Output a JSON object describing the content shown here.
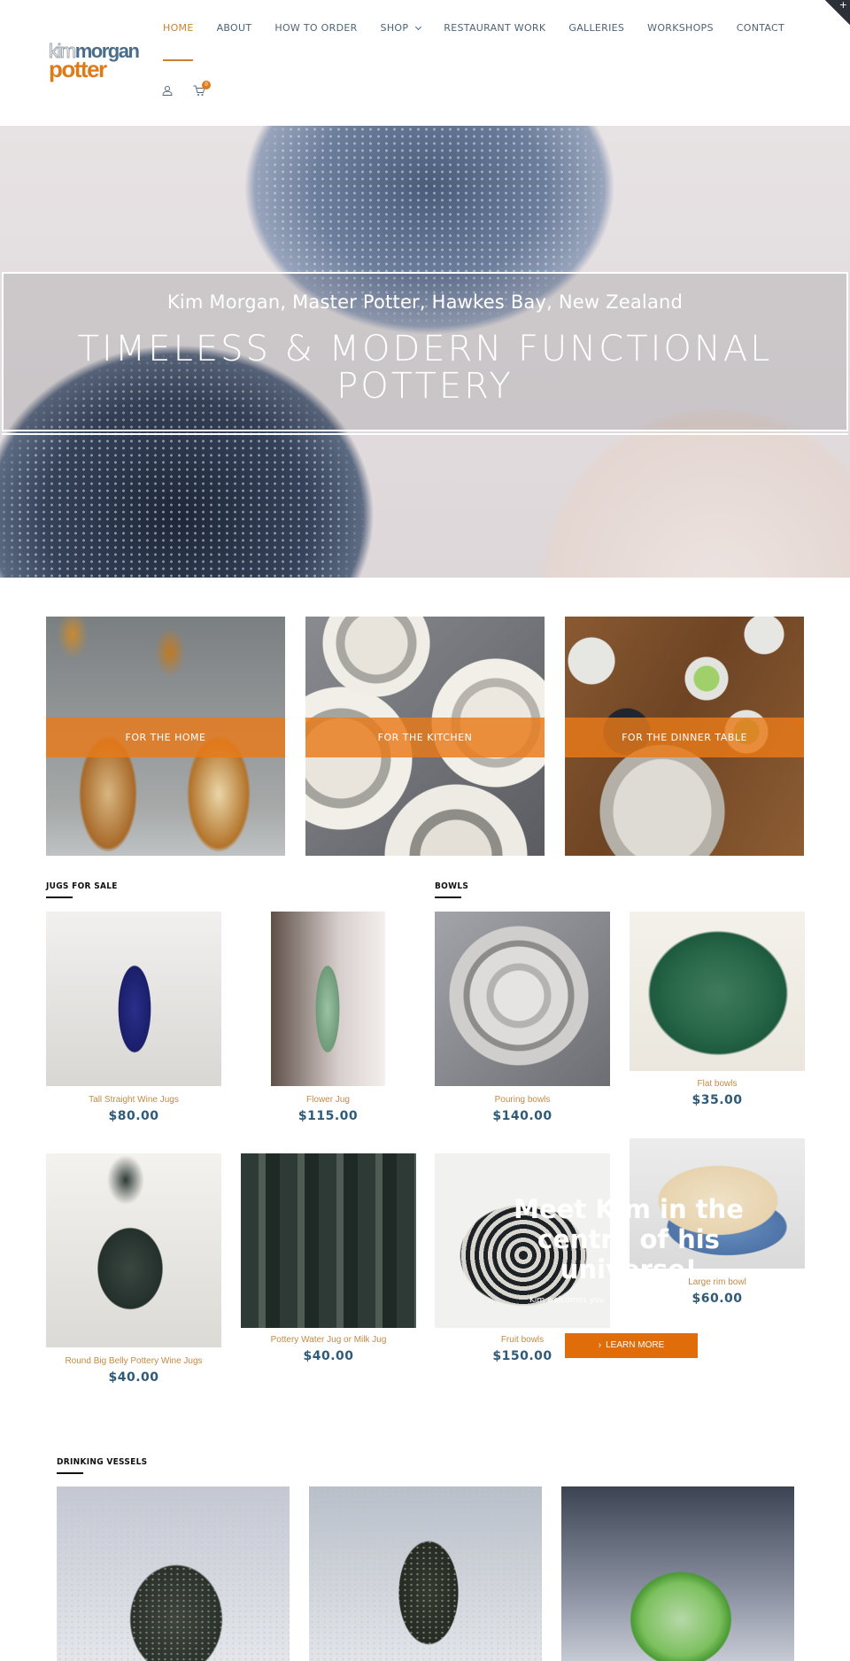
{
  "brand": {
    "logo_kim": "kim",
    "logo_morgan": "morgan",
    "logo_potter": "potter"
  },
  "nav": {
    "items": [
      {
        "label": "HOME",
        "active": true
      },
      {
        "label": "ABOUT"
      },
      {
        "label": "HOW TO ORDER"
      },
      {
        "label": "SHOP",
        "has_dropdown": true
      },
      {
        "label": "RESTAURANT WORK"
      },
      {
        "label": "GALLERIES"
      },
      {
        "label": "WORKSHOPS"
      },
      {
        "label": "CONTACT"
      }
    ],
    "cart_count": "0",
    "icons": [
      "user-icon",
      "cart-icon"
    ],
    "corner_toggle": "+"
  },
  "hero": {
    "subtitle": "Kim Morgan, Master Potter, Hawkes Bay, New Zealand",
    "title": "TIMELESS & MODERN FUNCTIONAL POTTERY"
  },
  "categories": [
    {
      "label": "FOR THE HOME"
    },
    {
      "label": "FOR THE KITCHEN"
    },
    {
      "label": "FOR THE DINNER TABLE"
    }
  ],
  "jugs": {
    "heading": "JUGS FOR SALE",
    "products": [
      {
        "name": "Tall Straight Wine Jugs",
        "price": "$80.00"
      },
      {
        "name": "Flower Jug",
        "price": "$115.00"
      },
      {
        "name": "Round Big Belly Pottery Wine Jugs",
        "price": "$40.00"
      },
      {
        "name": "Pottery Water Jug or Milk Jug",
        "price": "$40.00"
      }
    ]
  },
  "bowls": {
    "heading": "BOWLS",
    "products": [
      {
        "name": "Pouring bowls",
        "price": "$140.00"
      },
      {
        "name": "Flat bowls",
        "price": "$35.00"
      },
      {
        "name": "Fruit bowls",
        "price": "$150.00"
      },
      {
        "name": "Large rim bowl",
        "price": "$60.00"
      }
    ]
  },
  "promo": {
    "title": "Meet Kim in the centre of his universe!",
    "subtitle": "Kim welcomes you",
    "button": "LEARN MORE",
    "accent_color": "#e06d0a"
  },
  "drinking_vessels": {
    "heading": "DRINKING VESSELS"
  },
  "colors": {
    "accent_orange": "#e07b1a",
    "nav_text": "#4e6478",
    "price_blue": "#2f5a78",
    "product_name": "#c38a45"
  }
}
